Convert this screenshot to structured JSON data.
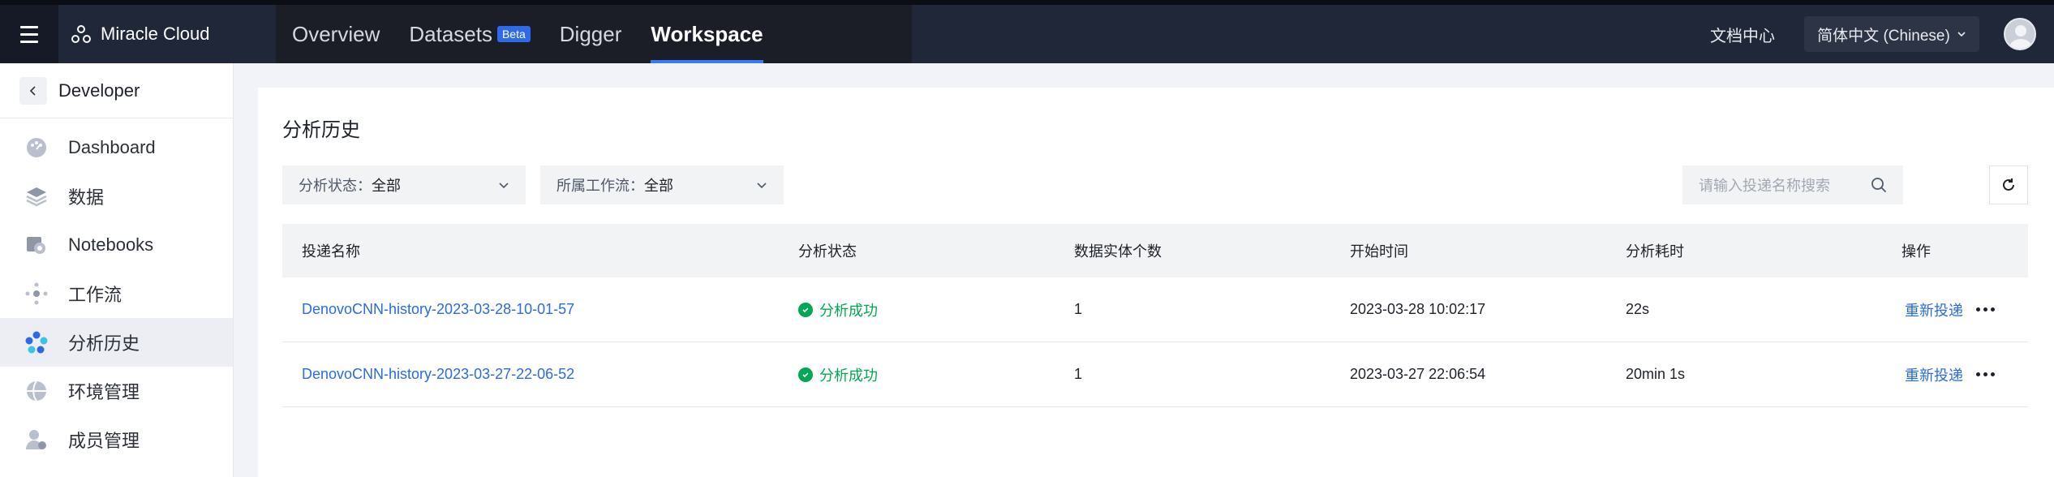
{
  "topbar": {
    "brand": "Miracle Cloud",
    "nav": [
      {
        "label": "Overview",
        "badge": ""
      },
      {
        "label": "Datasets",
        "badge": "Beta"
      },
      {
        "label": "Digger",
        "badge": ""
      },
      {
        "label": "Workspace",
        "badge": ""
      }
    ],
    "docs": "文档中心",
    "language": "简体中文 (Chinese)"
  },
  "sidebar": {
    "header": "Developer",
    "items": [
      {
        "label": "Dashboard",
        "icon": "dashboard-icon"
      },
      {
        "label": "数据",
        "icon": "layers-icon"
      },
      {
        "label": "Notebooks",
        "icon": "notebook-icon"
      },
      {
        "label": "工作流",
        "icon": "workflow-icon"
      },
      {
        "label": "分析历史",
        "icon": "history-icon"
      },
      {
        "label": "环境管理",
        "icon": "globe-icon"
      },
      {
        "label": "成员管理",
        "icon": "members-icon"
      }
    ]
  },
  "main": {
    "title": "分析历史",
    "filters": [
      {
        "label": "分析状态：",
        "value": "全部"
      },
      {
        "label": "所属工作流：",
        "value": "全部"
      }
    ],
    "search_placeholder": "请输入投递名称搜索",
    "columns": [
      "投递名称",
      "分析状态",
      "数据实体个数",
      "开始时间",
      "分析耗时",
      "操作"
    ],
    "rows": [
      {
        "name": "DenovoCNN-history-2023-03-28-10-01-57",
        "status": "分析成功",
        "entities": "1",
        "start": "2023-03-28 10:02:17",
        "duration": "22s",
        "action": "重新投递"
      },
      {
        "name": "DenovoCNN-history-2023-03-27-22-06-52",
        "status": "分析成功",
        "entities": "1",
        "start": "2023-03-27 22:06:54",
        "duration": "20min 1s",
        "action": "重新投递"
      }
    ]
  },
  "colors": {
    "accent": "#2a6ae8",
    "success": "#00a854",
    "topbar": "#202738"
  }
}
